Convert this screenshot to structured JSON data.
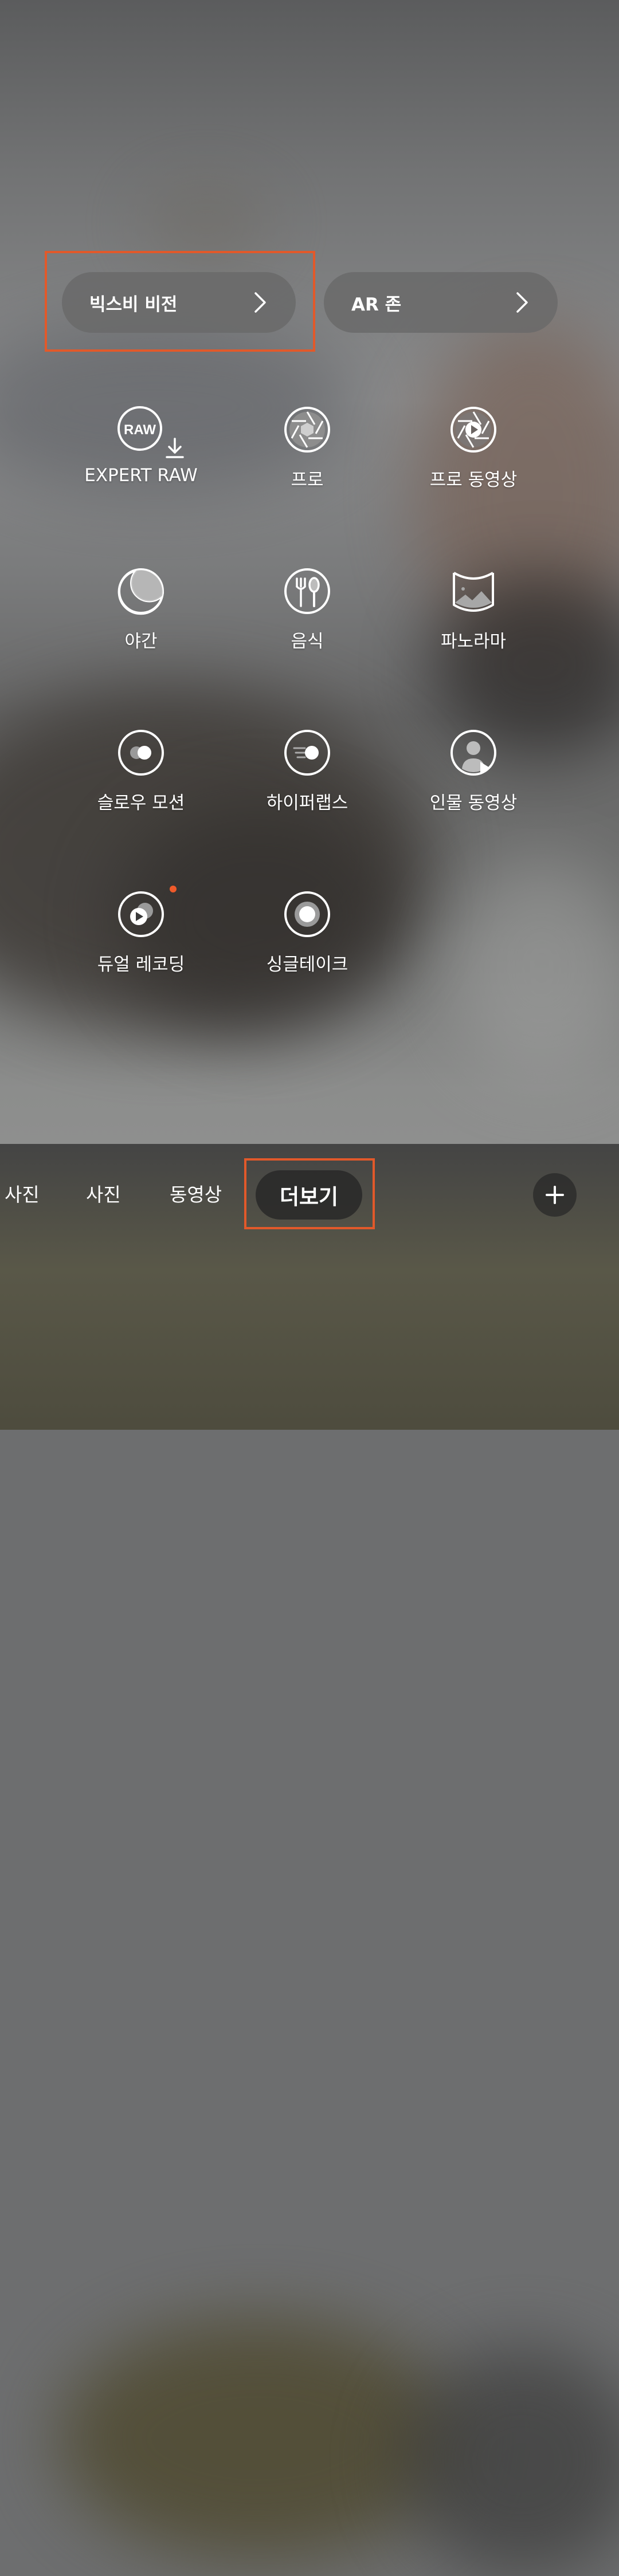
{
  "quick_links": [
    {
      "label": "빅스비 비전",
      "icon": "chevron-right-icon"
    },
    {
      "label": "AR 존",
      "icon": "chevron-right-icon"
    }
  ],
  "modes": [
    {
      "label": "EXPERT RAW",
      "icon": "raw-download-icon",
      "icon_text": "RAW"
    },
    {
      "label": "프로",
      "icon": "aperture-icon"
    },
    {
      "label": "프로 동영상",
      "icon": "aperture-play-icon"
    },
    {
      "label": "야간",
      "icon": "moon-icon"
    },
    {
      "label": "음식",
      "icon": "fork-spoon-icon"
    },
    {
      "label": "파노라마",
      "icon": "panorama-icon"
    },
    {
      "label": "슬로우 모션",
      "icon": "slow-motion-icon"
    },
    {
      "label": "하이퍼랩스",
      "icon": "hyperlapse-icon"
    },
    {
      "label": "인물 동영상",
      "icon": "portrait-video-icon"
    },
    {
      "label": "듀얼 레코딩",
      "icon": "dual-recording-icon",
      "has_new_badge": true
    },
    {
      "label": "싱글테이크",
      "icon": "single-take-icon"
    }
  ],
  "bottom_tabs": {
    "items": [
      "사진",
      "사진",
      "동영상"
    ],
    "active": "더보기",
    "add_icon": "plus-icon"
  },
  "colors": {
    "highlight": "#e2592a",
    "new_badge": "#ef5a2a"
  }
}
